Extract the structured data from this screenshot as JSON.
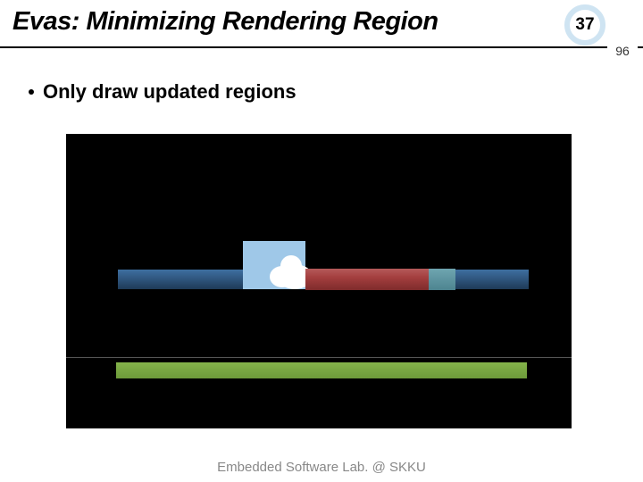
{
  "header": {
    "title": "Evas: Minimizing Rendering Region",
    "slide_number": "37",
    "total_slides": "96"
  },
  "content": {
    "bullet_1": "Only draw updated regions"
  },
  "figure": {
    "colors": {
      "canvas_bg": "#000000",
      "blue_strip": "#325a84",
      "sky_box": "#9fc8e8",
      "red_strip": "#a43f3f",
      "teal_strip": "#4d8490",
      "green_strip": "#6d9a3a"
    }
  },
  "footer": {
    "text": "Embedded Software Lab. @ SKKU"
  }
}
